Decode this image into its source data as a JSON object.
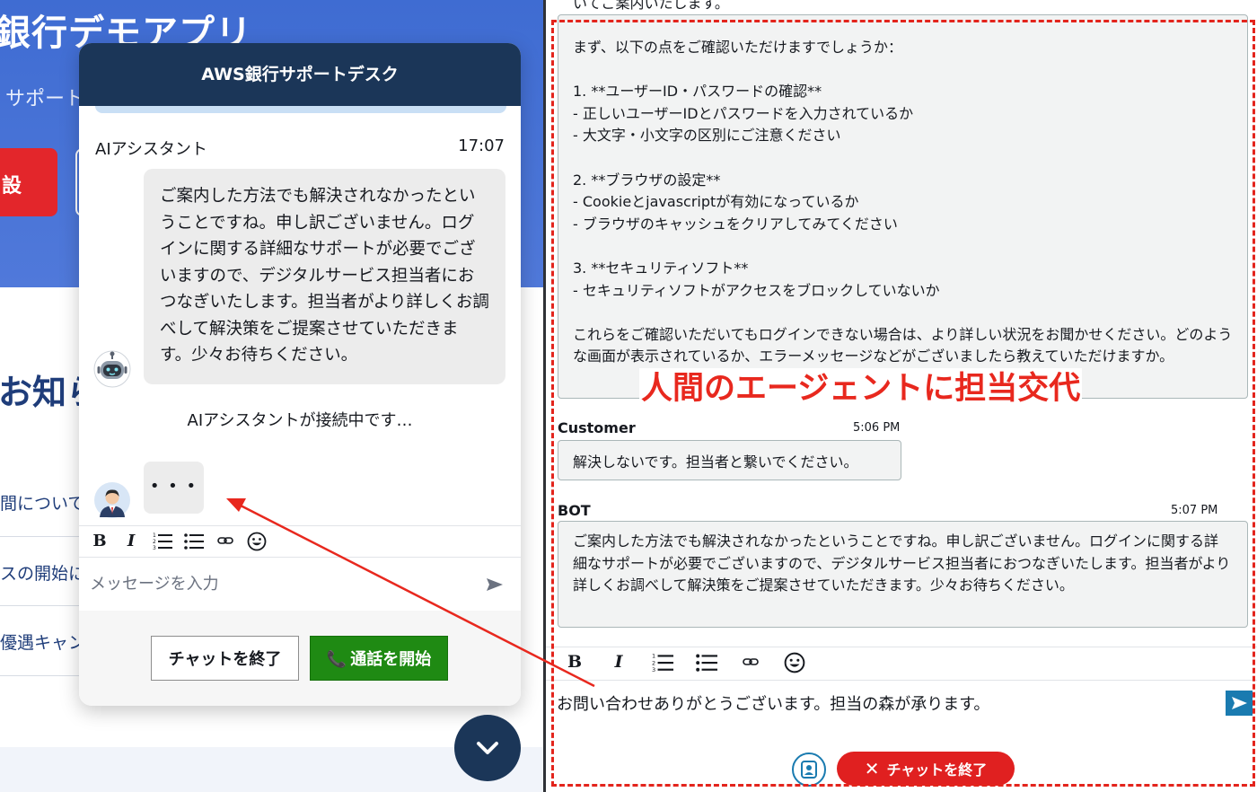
{
  "bank_page": {
    "title": "銀行デモアプリ",
    "subtitle": "サポート",
    "red_button_label": "設",
    "notice_heading": "お知ら",
    "links": [
      "間について",
      "スの開始に",
      "優遇キャン"
    ]
  },
  "widget": {
    "header_title": "AWS銀行サポートデスク",
    "message": {
      "sender": "AIアシスタント",
      "time": "17:07",
      "text": "ご案内した方法でも解決されなかったということですね。申し訳ございません。ログインに関する詳細なサポートが必要でございますので、デジタルサービス担当者におつなぎいたします。担当者がより詳しくお調べして解決策をご提案させていただきます。少々お待ちください。"
    },
    "connecting_text": "AIアシスタントが接続中です…",
    "typing_indicator": "• • •",
    "input_placeholder": "メッセージを入力",
    "end_chat_label": "チャットを終了",
    "call_label": "通話を開始"
  },
  "agent_panel": {
    "top_cut_text": "いてご案内いたします。",
    "first_message": "まず、以下の点をご確認いただけますでしょうか：\n\n1. **ユーザーID・パスワードの確認**\n- 正しいユーザーIDとパスワードを入力されているか\n- 大文字・小文字の区別にご注意ください\n\n2. **ブラウザの設定**\n- Cookieとjavascriptが有効になっているか\n- ブラウザのキャッシュをクリアしてみてください\n\n3. **セキュリティソフト**\n- セキュリティソフトがアクセスをブロックしていないか\n\nこれらをご確認いただいてもログインできない場合は、より詳しい状況をお聞かせください。どのような画面が表示されているか、エラーメッセージなどがございましたら教えていただけますか。",
    "customer": {
      "name": "Customer",
      "time": "5:06 PM",
      "text": "解決しないです。担当者と繋いでください。"
    },
    "bot": {
      "name": "BOT",
      "time": "5:07 PM",
      "text": "ご案内した方法でも解決されなかったということですね。申し訳ございません。ログインに関する詳細なサポートが必要でございますので、デジタルサービス担当者におつなぎいたします。担当者がより詳しくお調べして解決策をご提案させていただきます。少々お待ちください。"
    },
    "input_text": "お問い合わせありがとうございます。担当の森が承ります。",
    "end_chat_label": "チャットを終了"
  },
  "annotation": {
    "label": "人間のエージェントに担当交代",
    "color": "#e8281e"
  },
  "icons": {
    "bold": "B",
    "italic": "I",
    "emoji": "☺",
    "link": "⊖",
    "chevron": "chevron-down-icon"
  },
  "colors": {
    "header": "#1b3658",
    "call_button": "#1f8a13",
    "end_chat_red": "#e02020",
    "accent_blue": "#1a7bb0"
  }
}
